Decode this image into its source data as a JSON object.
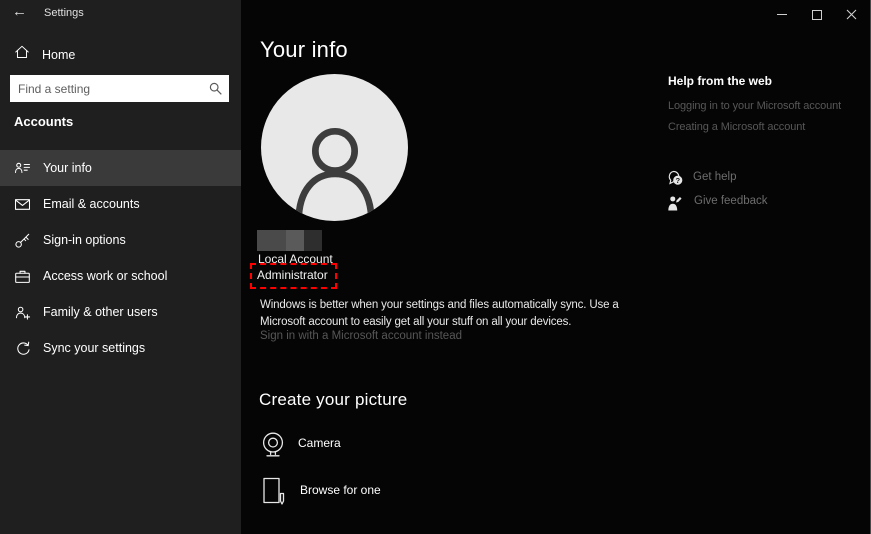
{
  "titlebar": {
    "title": "Settings",
    "back_glyph": "←"
  },
  "sidebar": {
    "home_label": "Home",
    "search_placeholder": "Find a setting",
    "section_heading": "Accounts",
    "items": [
      {
        "label": "Your info",
        "icon": "contact-card-icon",
        "selected": true
      },
      {
        "label": "Email & accounts",
        "icon": "envelope-icon",
        "selected": false
      },
      {
        "label": "Sign-in options",
        "icon": "key-icon",
        "selected": false
      },
      {
        "label": "Access work or school",
        "icon": "briefcase-icon",
        "selected": false
      },
      {
        "label": "Family & other users",
        "icon": "person-add-icon",
        "selected": false
      },
      {
        "label": "Sync your settings",
        "icon": "sync-icon",
        "selected": false
      }
    ]
  },
  "main": {
    "page_title": "Your info",
    "account": {
      "name_redacted": true,
      "account_type": "Local Account",
      "role": "Administrator",
      "role_annotation": "red-dashed-highlight"
    },
    "description_lines": [
      "Windows is better when your settings and files automatically sync. Use a",
      "Microsoft account to easily get all your stuff on all your devices."
    ],
    "sign_in_link": "Sign in with a Microsoft account instead",
    "create_picture_heading": "Create your picture",
    "camera_label": "Camera",
    "browse_label": "Browse for one"
  },
  "help": {
    "heading": "Help from the web",
    "links": [
      "Logging in to your Microsoft account",
      "Creating a Microsoft account"
    ],
    "get_help_label": "Get help",
    "give_feedback_label": "Give feedback"
  },
  "colors": {
    "sidebar_bg": "#1f1f1f",
    "main_bg": "#050505",
    "selected_item_bg": "#3a3a3a",
    "avatar_bg": "#e8e8e8",
    "dim_link": "#575757",
    "annotation_red": "#fe0000",
    "search_bg": "#ffffff"
  }
}
